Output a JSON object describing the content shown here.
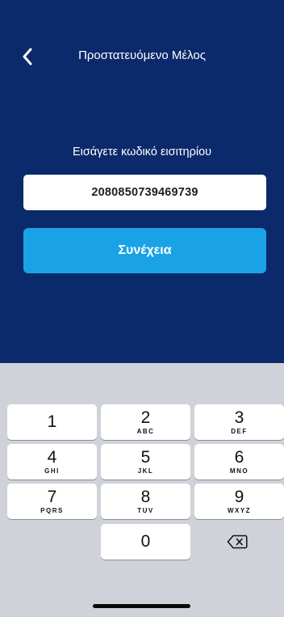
{
  "header": {
    "title": "Προστατευόμενο Μέλος",
    "back_icon": "chevron-left-icon"
  },
  "form": {
    "prompt": "Εισάγετε κωδικό εισιτηρίου",
    "ticket_code": "2080850739469739",
    "continue_label": "Συνέχεια"
  },
  "colors": {
    "header_background": "#0b2a6b",
    "button": "#19a3e6",
    "keyboard_background": "#cfd2d8"
  },
  "keypad": {
    "keys": [
      {
        "num": "1",
        "letters": ""
      },
      {
        "num": "2",
        "letters": "ABC"
      },
      {
        "num": "3",
        "letters": "DEF"
      },
      {
        "num": "4",
        "letters": "GHI"
      },
      {
        "num": "5",
        "letters": "JKL"
      },
      {
        "num": "6",
        "letters": "MNO"
      },
      {
        "num": "7",
        "letters": "PQRS"
      },
      {
        "num": "8",
        "letters": "TUV"
      },
      {
        "num": "9",
        "letters": "WXYZ"
      },
      {
        "num": "0",
        "letters": ""
      }
    ],
    "backspace_icon": "backspace-icon"
  }
}
